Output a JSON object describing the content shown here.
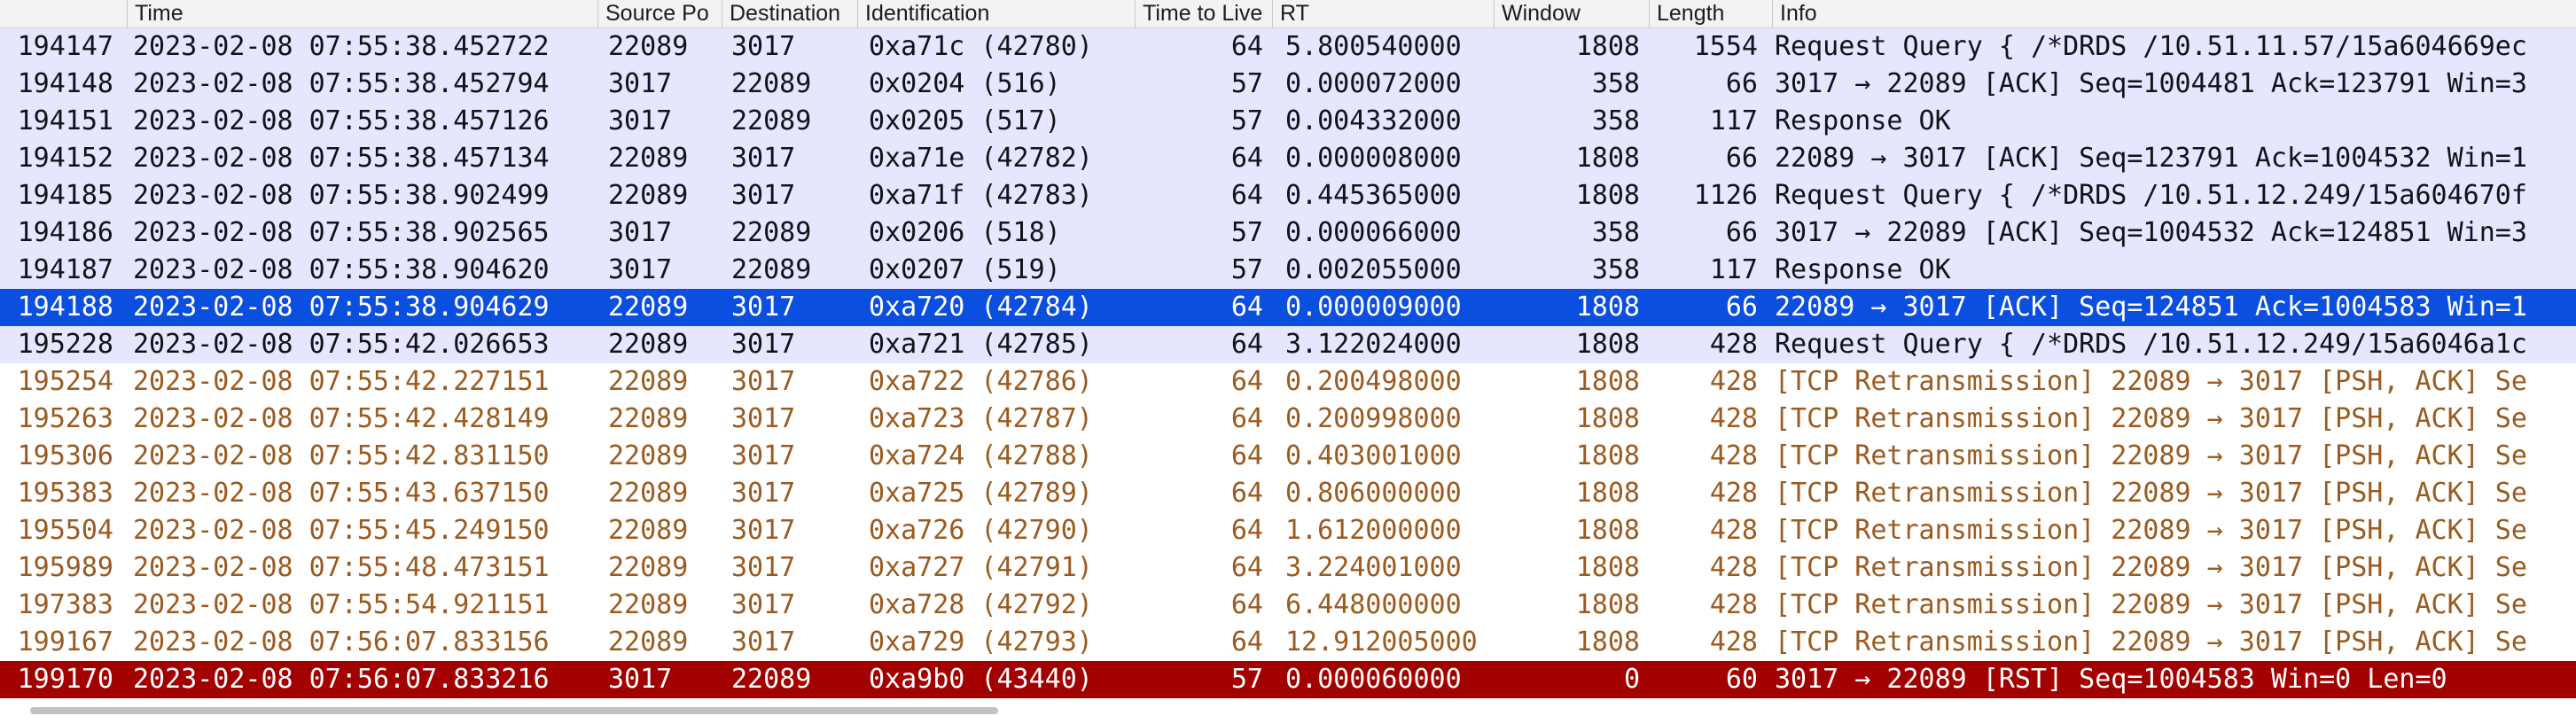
{
  "columns": [
    "",
    "Time",
    "Source Po",
    "Destination",
    "Identification",
    "Time to Live",
    "RT",
    "Window",
    "Length",
    "Info"
  ],
  "styles": {
    "normal": {
      "bg": "#e7e6ff",
      "fg": "#12131a"
    },
    "selected": {
      "bg": "#0a4fe0",
      "fg": "#ffffff"
    },
    "retrans": {
      "bg": "#ffffff",
      "fg": "#9b5a1f"
    },
    "rst": {
      "bg": "#a30000",
      "fg": "#ffffff"
    }
  },
  "rows": [
    {
      "style": "normal",
      "cells": [
        "194147",
        "2023-02-08 07:55:38.452722",
        "22089",
        "3017",
        "0xa71c (42780)",
        "64",
        "5.800540000",
        "1808",
        "1554",
        "Request Query { /*DRDS /10.51.11.57/15a604669ec"
      ]
    },
    {
      "style": "normal",
      "cells": [
        "194148",
        "2023-02-08 07:55:38.452794",
        "3017",
        "22089",
        "0x0204 (516)",
        "57",
        "0.000072000",
        "358",
        "66",
        "3017 → 22089 [ACK] Seq=1004481 Ack=123791 Win=3"
      ]
    },
    {
      "style": "normal",
      "cells": [
        "194151",
        "2023-02-08 07:55:38.457126",
        "3017",
        "22089",
        "0x0205 (517)",
        "57",
        "0.004332000",
        "358",
        "117",
        "Response  OK"
      ]
    },
    {
      "style": "normal",
      "cells": [
        "194152",
        "2023-02-08 07:55:38.457134",
        "22089",
        "3017",
        "0xa71e (42782)",
        "64",
        "0.000008000",
        "1808",
        "66",
        "22089 → 3017 [ACK] Seq=123791 Ack=1004532 Win=1"
      ]
    },
    {
      "style": "normal",
      "cells": [
        "194185",
        "2023-02-08 07:55:38.902499",
        "22089",
        "3017",
        "0xa71f (42783)",
        "64",
        "0.445365000",
        "1808",
        "1126",
        "Request Query { /*DRDS /10.51.12.249/15a604670f"
      ]
    },
    {
      "style": "normal",
      "cells": [
        "194186",
        "2023-02-08 07:55:38.902565",
        "3017",
        "22089",
        "0x0206 (518)",
        "57",
        "0.000066000",
        "358",
        "66",
        "3017 → 22089 [ACK] Seq=1004532 Ack=124851 Win=3"
      ]
    },
    {
      "style": "normal",
      "cells": [
        "194187",
        "2023-02-08 07:55:38.904620",
        "3017",
        "22089",
        "0x0207 (519)",
        "57",
        "0.002055000",
        "358",
        "117",
        "Response  OK"
      ]
    },
    {
      "style": "selected",
      "cells": [
        "194188",
        "2023-02-08 07:55:38.904629",
        "22089",
        "3017",
        "0xa720 (42784)",
        "64",
        "0.000009000",
        "1808",
        "66",
        "22089 → 3017 [ACK] Seq=124851 Ack=1004583 Win=1"
      ]
    },
    {
      "style": "normal",
      "cells": [
        "195228",
        "2023-02-08 07:55:42.026653",
        "22089",
        "3017",
        "0xa721 (42785)",
        "64",
        "3.122024000",
        "1808",
        "428",
        "Request Query { /*DRDS /10.51.12.249/15a6046a1c"
      ]
    },
    {
      "style": "retrans",
      "cells": [
        "195254",
        "2023-02-08 07:55:42.227151",
        "22089",
        "3017",
        "0xa722 (42786)",
        "64",
        "0.200498000",
        "1808",
        "428",
        "[TCP Retransmission] 22089 → 3017 [PSH, ACK] Se"
      ]
    },
    {
      "style": "retrans",
      "cells": [
        "195263",
        "2023-02-08 07:55:42.428149",
        "22089",
        "3017",
        "0xa723 (42787)",
        "64",
        "0.200998000",
        "1808",
        "428",
        "[TCP Retransmission] 22089 → 3017 [PSH, ACK] Se"
      ]
    },
    {
      "style": "retrans",
      "cells": [
        "195306",
        "2023-02-08 07:55:42.831150",
        "22089",
        "3017",
        "0xa724 (42788)",
        "64",
        "0.403001000",
        "1808",
        "428",
        "[TCP Retransmission] 22089 → 3017 [PSH, ACK] Se"
      ]
    },
    {
      "style": "retrans",
      "cells": [
        "195383",
        "2023-02-08 07:55:43.637150",
        "22089",
        "3017",
        "0xa725 (42789)",
        "64",
        "0.806000000",
        "1808",
        "428",
        "[TCP Retransmission] 22089 → 3017 [PSH, ACK] Se"
      ]
    },
    {
      "style": "retrans",
      "cells": [
        "195504",
        "2023-02-08 07:55:45.249150",
        "22089",
        "3017",
        "0xa726 (42790)",
        "64",
        "1.612000000",
        "1808",
        "428",
        "[TCP Retransmission] 22089 → 3017 [PSH, ACK] Se"
      ]
    },
    {
      "style": "retrans",
      "cells": [
        "195989",
        "2023-02-08 07:55:48.473151",
        "22089",
        "3017",
        "0xa727 (42791)",
        "64",
        "3.224001000",
        "1808",
        "428",
        "[TCP Retransmission] 22089 → 3017 [PSH, ACK] Se"
      ]
    },
    {
      "style": "retrans",
      "cells": [
        "197383",
        "2023-02-08 07:55:54.921151",
        "22089",
        "3017",
        "0xa728 (42792)",
        "64",
        "6.448000000",
        "1808",
        "428",
        "[TCP Retransmission] 22089 → 3017 [PSH, ACK] Se"
      ]
    },
    {
      "style": "retrans",
      "cells": [
        "199167",
        "2023-02-08 07:56:07.833156",
        "22089",
        "3017",
        "0xa729 (42793)",
        "64",
        "12.912005000",
        "1808",
        "428",
        "[TCP Retransmission] 22089 → 3017 [PSH, ACK] Se"
      ]
    },
    {
      "style": "rst",
      "cells": [
        "199170",
        "2023-02-08 07:56:07.833216",
        "3017",
        "22089",
        "0xa9b0 (43440)",
        "57",
        "0.000060000",
        "0",
        "60",
        "3017 → 22089 [RST] Seq=1004583 Win=0 Len=0"
      ]
    }
  ]
}
